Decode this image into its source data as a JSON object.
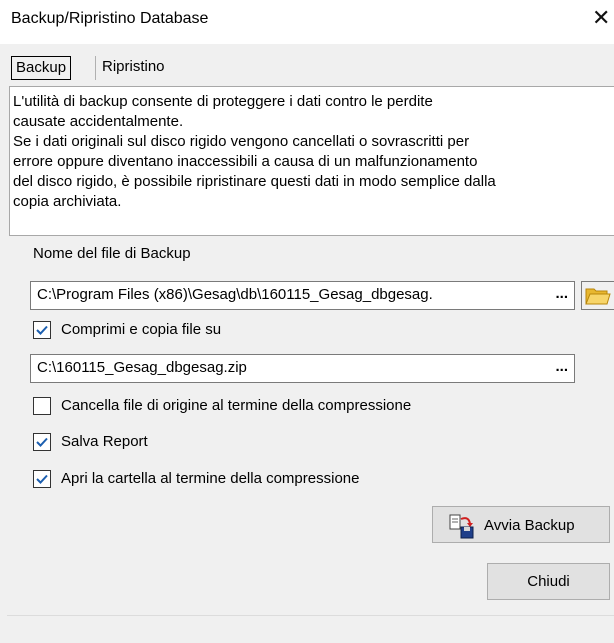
{
  "window": {
    "title": "Backup/Ripristino Database"
  },
  "tabs": [
    {
      "label": "Backup",
      "active": true
    },
    {
      "label": "Ripristino",
      "active": false
    }
  ],
  "info_lines": [
    "L'utilità di backup consente di proteggere i dati contro le perdite",
    "causate accidentalmente.",
    "Se i dati originali sul disco rigido vengono cancellati o sovrascritti per",
    "errore oppure diventano inaccessibili a causa di un malfunzionamento",
    "del disco rigido, è possibile ripristinare questi dati in modo semplice dalla",
    "copia archiviata."
  ],
  "backup_file": {
    "label": "Nome del file di Backup",
    "value": "C:\\Program Files (x86)\\Gesag\\db\\160115_Gesag_dbgesag.",
    "browse_label": "..."
  },
  "options": {
    "compress": {
      "label": "Comprimi e copia file su",
      "checked": true
    },
    "zip_path": {
      "value": "C:\\160115_Gesag_dbgesag.zip",
      "browse_label": "..."
    },
    "delete_source": {
      "label": "Cancella file di origine al termine della compressione",
      "checked": false
    },
    "save_report": {
      "label": "Salva Report",
      "checked": true
    },
    "open_folder": {
      "label": "Apri la cartella al termine della compressione",
      "checked": true
    }
  },
  "buttons": {
    "start_backup": "Avvia Backup",
    "close": "Chiudi"
  },
  "colors": {
    "check_accent": "#1c5fb0",
    "folder_icon": "#f2c94c"
  }
}
